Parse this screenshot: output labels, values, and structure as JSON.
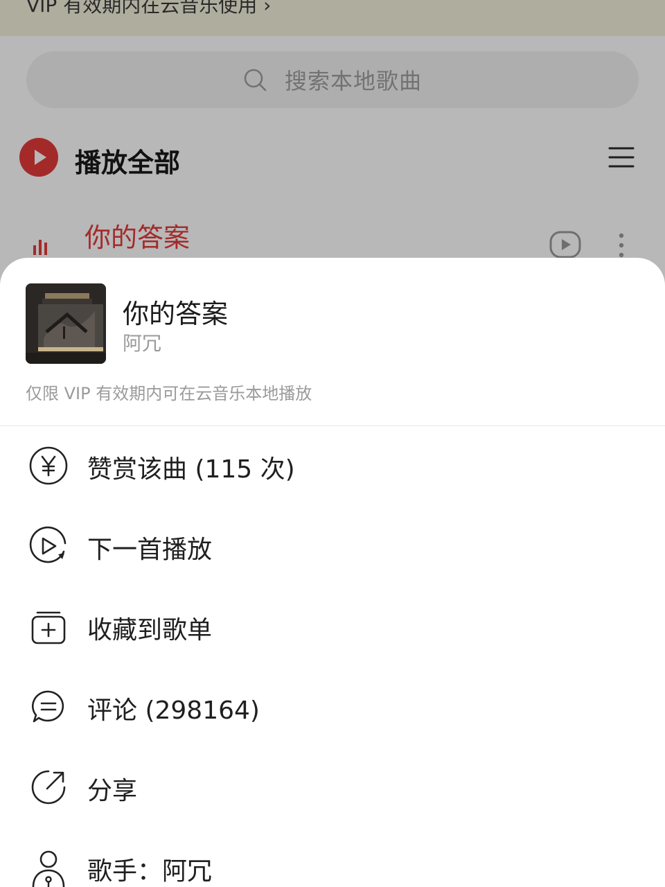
{
  "banner": {
    "text": "VIP 有效期内在云音乐使用 ›"
  },
  "search": {
    "placeholder": "搜索本地歌曲"
  },
  "play_all": {
    "label": "播放全部"
  },
  "current_song": {
    "title": "你的答案"
  },
  "sheet": {
    "title": "你的答案",
    "artist": "阿冗",
    "note": "仅限 VIP 有效期内可在云音乐本地播放",
    "menu": [
      {
        "label": "赞赏该曲 (115 次)",
        "icon": "yen-reward-icon"
      },
      {
        "label": "下一首播放",
        "icon": "play-next-icon"
      },
      {
        "label": "收藏到歌单",
        "icon": "add-to-playlist-icon"
      },
      {
        "label": "评论 (298164)",
        "icon": "comment-icon"
      },
      {
        "label": "分享",
        "icon": "share-icon"
      },
      {
        "label": "歌手：阿冗",
        "icon": "artist-icon"
      }
    ]
  },
  "colors": {
    "accent": "#e33b3b",
    "banner_bg": "#f3f0dc",
    "overlay": "rgba(0,0,0,0.28)"
  }
}
